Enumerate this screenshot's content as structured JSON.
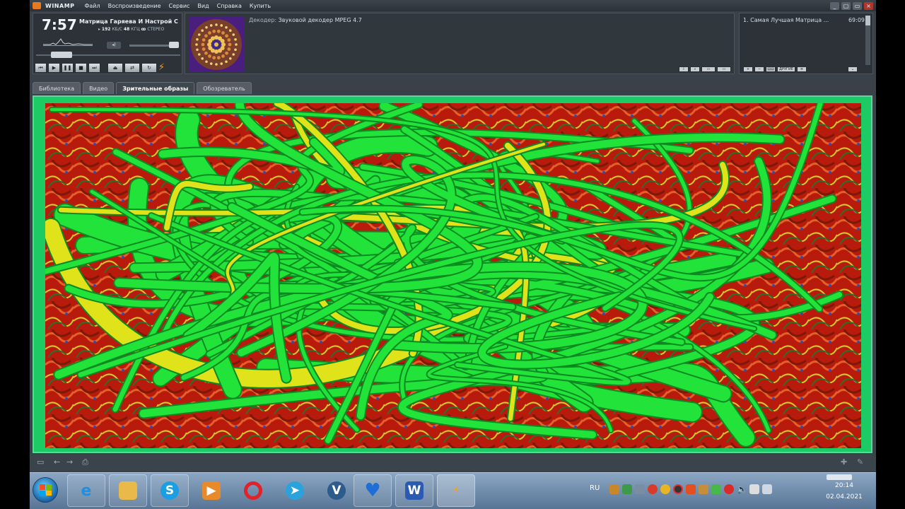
{
  "app": {
    "brand": "WINAMP",
    "menu": [
      "Файл",
      "Воспроизведение",
      "Сервис",
      "Вид",
      "Справка",
      "Купить"
    ],
    "window_buttons": [
      "_",
      "▢",
      "▭",
      "×"
    ]
  },
  "player": {
    "time": "7:57",
    "track_title": "Матрица Гаряева И Настрой С",
    "bitrate_value": "192",
    "bitrate_unit": "КБ/С",
    "samplerate_value": "48",
    "samplerate_unit": "КГЦ",
    "channels": "СТЕРЕО",
    "seek_progress": 0.12,
    "volume": 0.9,
    "controls": [
      "prev",
      "play",
      "pause",
      "stop",
      "next",
      "eject",
      "shuffle",
      "repeat"
    ]
  },
  "info": {
    "decoder_label": "Декодер:",
    "decoder_value": "Звуковой декодер MPEG 4.7"
  },
  "playlist": {
    "items": [
      {
        "name": "1. Самая Лучшая Матрица ...",
        "duration": "69:09"
      }
    ],
    "buttons": [
      "+",
      "−",
      "▤▤",
      "ДРУГИЕ",
      "≡",
      "⌄"
    ]
  },
  "tabs": [
    {
      "label": "Библиотека",
      "active": false
    },
    {
      "label": "Видео",
      "active": false
    },
    {
      "label": "Зрительные образы",
      "active": true
    },
    {
      "label": "Обозреватель",
      "active": false
    }
  ],
  "visualization": {
    "colors": {
      "base": "#b01a0c",
      "green": "#22e33a",
      "dark_green": "#0e8a22",
      "yellow": "#e0e31a",
      "frame": "#1ccb63"
    }
  },
  "taskbar": {
    "apps": [
      "Internet Explorer",
      "Explorer",
      "Skype",
      "Media Player",
      "Opera",
      "Telegram",
      "VPN",
      "Heart",
      "Word",
      "Winamp"
    ],
    "language": "RU",
    "time": "20:14",
    "date": "02.04.2021"
  }
}
